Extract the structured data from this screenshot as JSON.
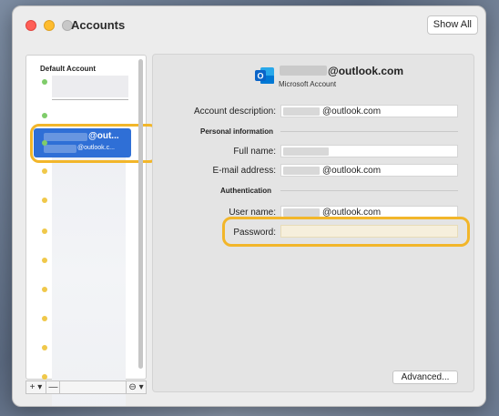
{
  "window": {
    "title": "Accounts",
    "show_all_label": "Show All"
  },
  "sidebar": {
    "header": "Default Account",
    "selected_account": {
      "name_suffix": "@out...",
      "email_suffix": "@outlook.c..."
    },
    "status_dots": [
      "green",
      "green",
      "green",
      "yellow",
      "yellow",
      "yellow",
      "yellow",
      "yellow",
      "yellow",
      "yellow",
      "yellow",
      "yellow"
    ],
    "add_label": "+ ▾",
    "remove_label": "—",
    "action_label": "⊖ ▾"
  },
  "account": {
    "email_suffix": "@outlook.com",
    "type": "Microsoft Account",
    "description_label": "Account description:",
    "description_value": "@outlook.com",
    "personal_info_label": "Personal information",
    "full_name_label": "Full name:",
    "email_label": "E-mail address:",
    "email_value": "@outlook.com",
    "authentication_label": "Authentication",
    "username_label": "User name:",
    "username_value": "@outlook.com",
    "password_label": "Password:",
    "password_value": "",
    "advanced_label": "Advanced..."
  },
  "colors": {
    "selection": "#2f6fd6",
    "annotation": "#f2b62a",
    "online_dot": "#7fcc6a",
    "pending_dot": "#f0c84a",
    "outlook_blue": "#0a64c8"
  }
}
